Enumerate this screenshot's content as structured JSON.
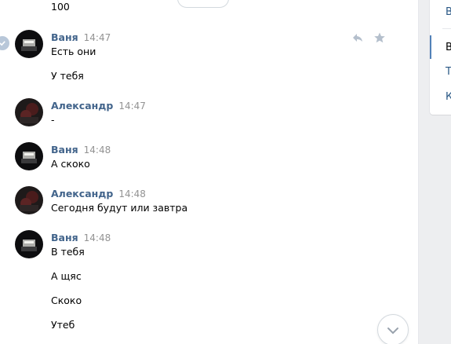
{
  "previous_message": {
    "text": "100"
  },
  "right_menu": {
    "items": [
      {
        "label": "В"
      },
      {
        "label": "В"
      },
      {
        "label": "Т"
      },
      {
        "label": "К"
      }
    ]
  },
  "messages": [
    {
      "author": "Ваня",
      "time": "14:47",
      "lines": [
        "Есть они",
        "У тебя"
      ]
    },
    {
      "author": "Александр",
      "time": "14:47",
      "lines": [
        "-"
      ]
    },
    {
      "author": "Ваня",
      "time": "14:48",
      "lines": [
        "А скоко"
      ]
    },
    {
      "author": "Александр",
      "time": "14:48",
      "lines": [
        "Сегодня будут или завтра"
      ]
    },
    {
      "author": "Ваня",
      "time": "14:48",
      "lines": [
        "В тебя",
        "А щяс",
        "Скоко",
        "Утеб"
      ]
    }
  ],
  "colors": {
    "author": "#42648b",
    "time": "#939393",
    "accent": "#5181b8"
  },
  "icons": {
    "reply": "reply-icon",
    "star": "star-icon",
    "scroll": "chevron-down-icon",
    "select": "check-icon"
  }
}
